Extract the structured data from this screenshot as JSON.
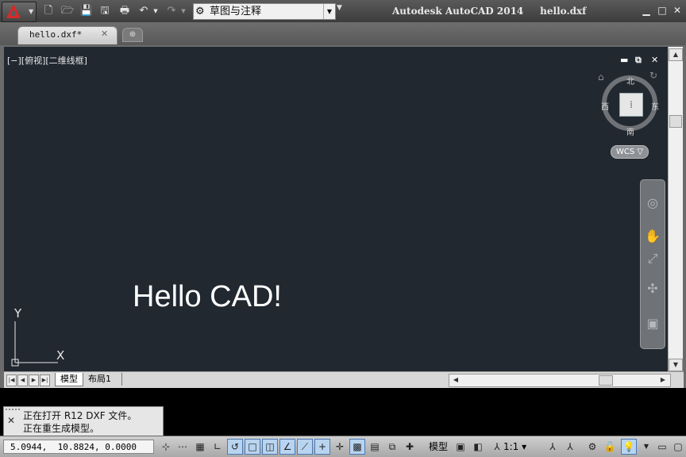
{
  "window": {
    "title": "Autodesk AutoCAD 2014     hello.dxf",
    "minimize_icon": "minimize-icon",
    "restore_icon": "restore-icon",
    "close_icon": "close-icon"
  },
  "quick_access": {
    "workspace": "草图与注释",
    "icons": [
      "new-icon",
      "open-icon",
      "save-icon",
      "save-as-icon",
      "print-icon",
      "undo-icon",
      "redo-icon",
      "customize-dropdown-icon"
    ]
  },
  "tabs": {
    "active_label": "hello.dxf*",
    "close": "✕"
  },
  "viewport": {
    "label": "[−][俯视][二维线框]",
    "text_entity": "Hello CAD!",
    "ucs_x": "X",
    "ucs_y": "Y"
  },
  "viewcube": {
    "north": "北",
    "south": "南",
    "east": "东",
    "west": "西",
    "wcs": "WCS ▽"
  },
  "layout_tabs": {
    "model": "模型",
    "layout1": "布局1"
  },
  "command": {
    "lines": [
      "正在打开 R12 DXF 文件。",
      "正在重生成模型。"
    ]
  },
  "status": {
    "coordinates": "5.0944,  10.8824, 0.0000",
    "model_button": "模型",
    "annotation_scale": "1:1 ▾"
  },
  "colors": {
    "canvas": "#212830",
    "title_bar": "#4a4a4a",
    "accent_red": "#d42a2a"
  }
}
